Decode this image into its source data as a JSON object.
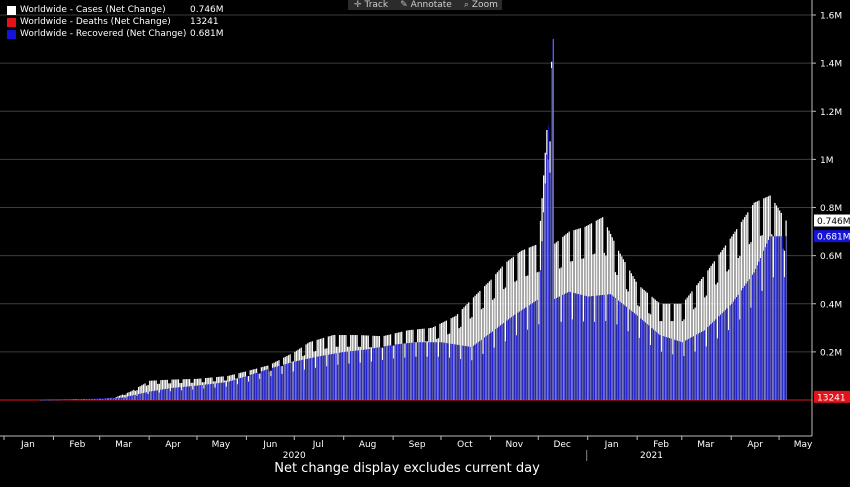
{
  "toolbar": {
    "track_label": "Track",
    "annotate_label": "Annotate",
    "zoom_label": "Zoom"
  },
  "legend": [
    {
      "name": "Worldwide - Cases (Net Change)",
      "value": "0.746M",
      "color": "#ffffff"
    },
    {
      "name": "Worldwide - Deaths (Net Change)",
      "value": "13241",
      "color": "#e3121b"
    },
    {
      "name": "Worldwide - Recovered (Net Change)",
      "value": "0.681M",
      "color": "#1414d8"
    }
  ],
  "footer_note": "Net change display excludes current day",
  "chart_data": {
    "type": "bar",
    "y_ticks": [
      {
        "value": 1600000,
        "label": "1.6M"
      },
      {
        "value": 1400000,
        "label": "1.4M"
      },
      {
        "value": 1200000,
        "label": "1.2M"
      },
      {
        "value": 1000000,
        "label": "1M"
      },
      {
        "value": 800000,
        "label": "0.8M"
      },
      {
        "value": 600000,
        "label": "0.6M"
      },
      {
        "value": 400000,
        "label": "0.4M"
      },
      {
        "value": 200000,
        "label": "0.2M"
      }
    ],
    "ylim": [
      -300000,
      1600000
    ],
    "x_months": [
      "Jan",
      "Feb",
      "Mar",
      "Apr",
      "May",
      "Jun",
      "Jul",
      "Aug",
      "Sep",
      "Oct",
      "Nov",
      "Dec",
      "Jan",
      "Feb",
      "Mar",
      "Apr",
      "May"
    ],
    "x_years": [
      {
        "label": "2020",
        "month_index": 6
      },
      {
        "label": "2021",
        "month_index": 13.3
      }
    ],
    "grid": true,
    "colors": {
      "cases": "#ffffff",
      "deaths": "#e3121b",
      "recovered": "#1414d8",
      "zero_line": "#e3121b"
    },
    "last_value_tags": [
      {
        "label": "0.746M",
        "value": 746000,
        "series": "cases"
      },
      {
        "label": "0.681M",
        "value": 681000,
        "series": "recovered"
      },
      {
        "label": "13241",
        "value": 13241,
        "series": "deaths"
      }
    ],
    "series": [
      {
        "name": "Worldwide - Cases (Net Change)",
        "points": [
          [
            "2020-01-22",
            0
          ],
          [
            "2020-02-15",
            3000
          ],
          [
            "2020-03-01",
            5000
          ],
          [
            "2020-03-10",
            10000
          ],
          [
            "2020-03-20",
            35000
          ],
          [
            "2020-04-01",
            80000
          ],
          [
            "2020-04-15",
            85000
          ],
          [
            "2020-05-01",
            88000
          ],
          [
            "2020-05-20",
            100000
          ],
          [
            "2020-06-01",
            120000
          ],
          [
            "2020-06-15",
            145000
          ],
          [
            "2020-07-01",
            200000
          ],
          [
            "2020-07-10",
            240000
          ],
          [
            "2020-07-25",
            270000
          ],
          [
            "2020-08-10",
            270000
          ],
          [
            "2020-08-25",
            265000
          ],
          [
            "2020-09-10",
            290000
          ],
          [
            "2020-09-25",
            300000
          ],
          [
            "2020-10-10",
            350000
          ],
          [
            "2020-10-20",
            420000
          ],
          [
            "2020-11-01",
            500000
          ],
          [
            "2020-11-10",
            570000
          ],
          [
            "2020-11-20",
            620000
          ],
          [
            "2020-12-01",
            650000
          ],
          [
            "2020-12-10",
            1500000
          ],
          [
            "2020-12-11",
            650000
          ],
          [
            "2020-12-20",
            700000
          ],
          [
            "2020-12-30",
            720000
          ],
          [
            "2021-01-10",
            760000
          ],
          [
            "2021-01-20",
            620000
          ],
          [
            "2021-02-01",
            480000
          ],
          [
            "2021-02-15",
            400000
          ],
          [
            "2021-03-01",
            400000
          ],
          [
            "2021-03-15",
            520000
          ],
          [
            "2021-04-01",
            680000
          ],
          [
            "2021-04-15",
            820000
          ],
          [
            "2021-04-25",
            850000
          ],
          [
            "2021-05-05",
            746000
          ]
        ]
      },
      {
        "name": "Worldwide - Recovered (Net Change)",
        "points": [
          [
            "2020-01-22",
            0
          ],
          [
            "2020-02-15",
            2000
          ],
          [
            "2020-03-01",
            8000
          ],
          [
            "2020-03-15",
            10000
          ],
          [
            "2020-04-01",
            35000
          ],
          [
            "2020-04-15",
            50000
          ],
          [
            "2020-05-01",
            60000
          ],
          [
            "2020-05-20",
            75000
          ],
          [
            "2020-06-01",
            100000
          ],
          [
            "2020-06-15",
            130000
          ],
          [
            "2020-07-01",
            160000
          ],
          [
            "2020-07-15",
            180000
          ],
          [
            "2020-08-01",
            200000
          ],
          [
            "2020-08-15",
            210000
          ],
          [
            "2020-09-01",
            230000
          ],
          [
            "2020-09-15",
            240000
          ],
          [
            "2020-10-01",
            240000
          ],
          [
            "2020-10-20",
            220000
          ],
          [
            "2020-11-01",
            280000
          ],
          [
            "2020-11-15",
            350000
          ],
          [
            "2020-12-01",
            420000
          ],
          [
            "2020-12-10",
            1500000
          ],
          [
            "2020-12-11",
            420000
          ],
          [
            "2020-12-20",
            450000
          ],
          [
            "2021-01-01",
            430000
          ],
          [
            "2021-01-15",
            440000
          ],
          [
            "2021-02-01",
            350000
          ],
          [
            "2021-02-15",
            270000
          ],
          [
            "2021-03-01",
            240000
          ],
          [
            "2021-03-15",
            290000
          ],
          [
            "2021-04-01",
            400000
          ],
          [
            "2021-04-15",
            530000
          ],
          [
            "2021-04-25",
            680000
          ],
          [
            "2021-05-05",
            681000
          ]
        ]
      },
      {
        "name": "Worldwide - Deaths (Net Change)",
        "points": [
          [
            "2020-01-22",
            0
          ],
          [
            "2020-04-15",
            7000
          ],
          [
            "2020-08-01",
            6000
          ],
          [
            "2020-12-01",
            10000
          ],
          [
            "2021-01-20",
            14000
          ],
          [
            "2021-03-01",
            9000
          ],
          [
            "2021-05-05",
            13241
          ]
        ]
      }
    ]
  }
}
